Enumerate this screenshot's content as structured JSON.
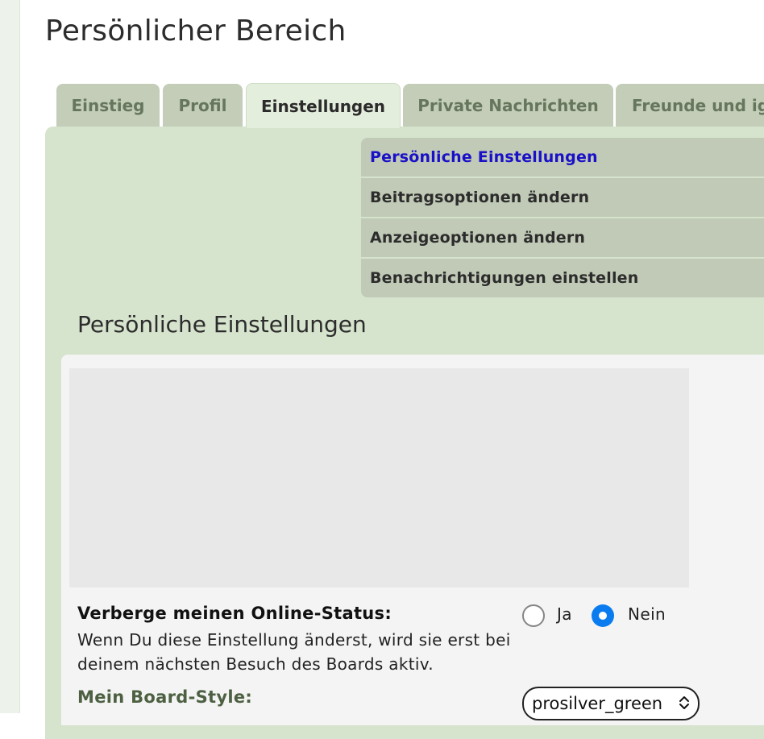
{
  "page": {
    "title": "Persönlicher Bereich"
  },
  "tabs": [
    {
      "label": "Einstieg"
    },
    {
      "label": "Profil"
    },
    {
      "label": "Einstellungen"
    },
    {
      "label": "Private Nachrichten"
    },
    {
      "label": "Freunde und ig"
    }
  ],
  "submenu": {
    "items": [
      {
        "label": "Persönliche Einstellungen"
      },
      {
        "label": "Beitragsoptionen ändern"
      },
      {
        "label": "Anzeigeoptionen ändern"
      },
      {
        "label": "Benachrichtigungen einstellen"
      }
    ],
    "active_color": "#1a10c8"
  },
  "section": {
    "title": "Persönliche Einstellungen"
  },
  "online_status": {
    "label": "Verberge meinen Online-Status:",
    "description": "Wenn Du diese Einstellung änderst, wird sie erst bei deinem nächsten Besuch des Boards aktiv.",
    "option_yes": "Ja",
    "option_no": "Nein",
    "selected": "Nein"
  },
  "board_style": {
    "label": "Mein Board-Style:",
    "selected": "prosilver_green"
  },
  "colors": {
    "panel": "#d6e3cd",
    "tab": "#c3cdb8",
    "radio_selected": "#0b7cf0"
  }
}
